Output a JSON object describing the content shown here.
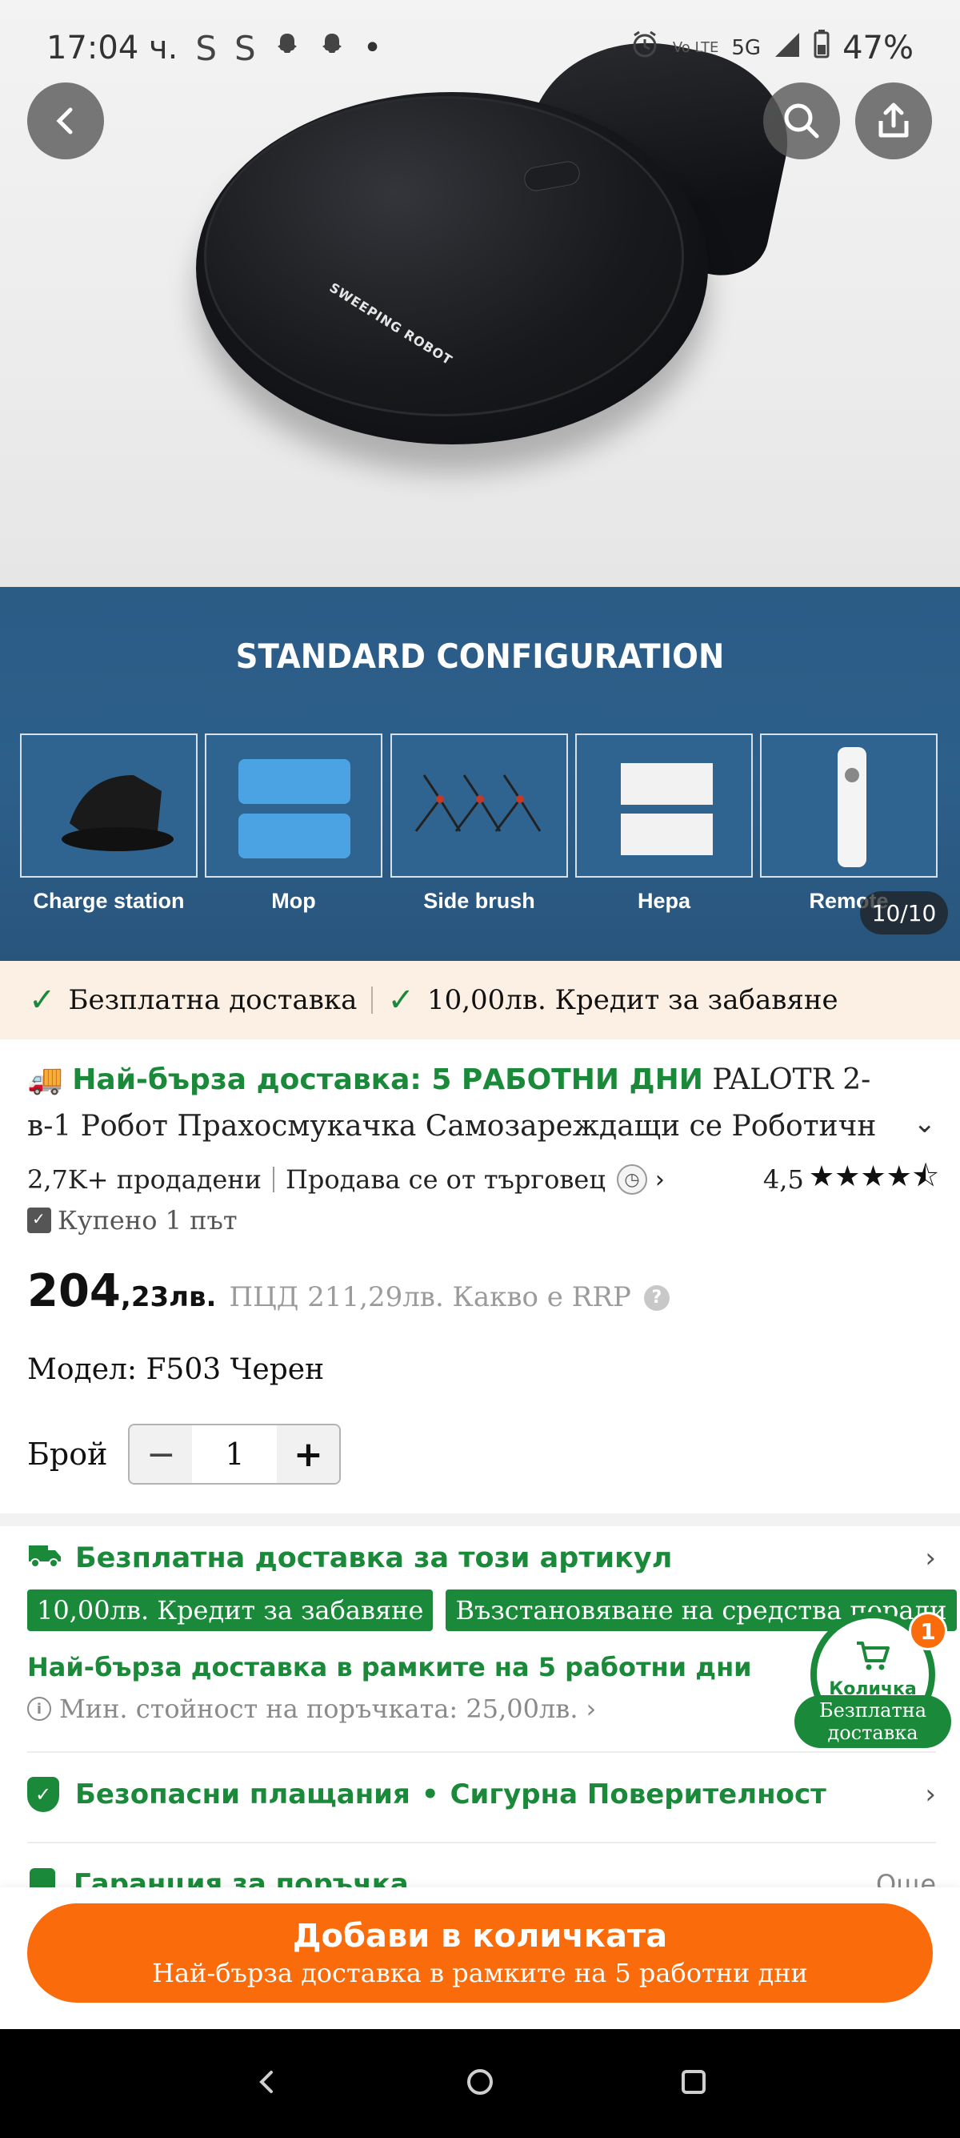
{
  "status_bar": {
    "time": "17:04 ч.",
    "icons_left": [
      "S",
      "S",
      "snapchat-icon",
      "snapchat-icon",
      "•"
    ],
    "network": "5G",
    "volte": "Vo LTE",
    "battery": "47%"
  },
  "gallery": {
    "robot_label": "SWEEPING ROBOT",
    "config_title": "STANDARD CONFIGURATION",
    "config_items": [
      "Charge station",
      "Mop",
      "Side brush",
      "Hepa",
      "Remote"
    ],
    "pager": "10/10"
  },
  "promo_strip": {
    "item1": "Безплатна доставка",
    "item2": "10,00лв. Кредит за забавяне"
  },
  "product": {
    "fast_badge": "Най-бърза доставка: 5 РАБОТНИ ДНИ",
    "title": "PALOTR 2-в-1 Робот Прахосмукачка Самозареждащи се Роботичн",
    "sold": "2,7K+ продадени",
    "seller": "Продава се от търговец",
    "rating": "4,5",
    "rating_value": 4.5,
    "bought": "Купено 1 път",
    "price_main": "204",
    "price_dec": ",23лв.",
    "price_rrp": "ПЦД 211,29лв. Какво е RRP",
    "model": "Модел: F503 Черен",
    "qty_label": "Брой",
    "qty_value": "1"
  },
  "shipping": {
    "free_ship": "Безплатна доставка за този артикул",
    "tag1": "10,00лв. Кредит за забавяне",
    "tag2": "Възстановяване на средства поради",
    "fast_ship": "Най-бърза доставка в рамките на 5 работни дни",
    "min_order": "Мин. стойност на поръчката: 25,00лв."
  },
  "security": {
    "payments": "Безопасни плащания",
    "privacy": "Сигурна Поверителност"
  },
  "guarantee": {
    "label": "Гаранция за поръчка",
    "more": "Още"
  },
  "cart": {
    "label": "Количка",
    "count": "1",
    "pill": "Безплатна доставка"
  },
  "cta": {
    "main": "Добави в количката",
    "sub": "Най-бърза доставка в рамките на 5 работни дни"
  },
  "colors": {
    "accent_green": "#1a8a3a",
    "cta_orange": "#fa6b0c",
    "banner_blue": "#2d5f8b"
  }
}
